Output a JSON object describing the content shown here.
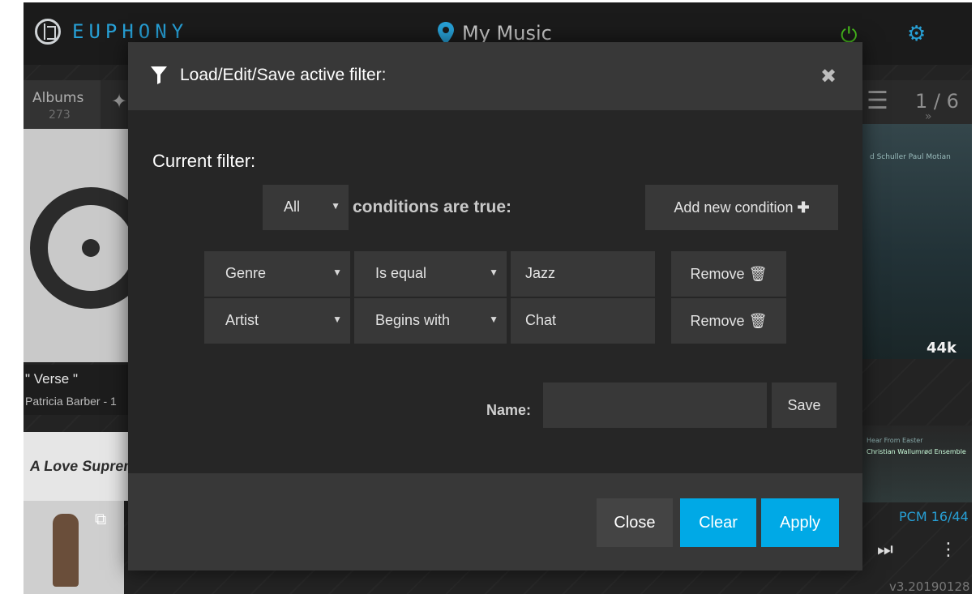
{
  "app": {
    "brand": "EUPHONY",
    "location": "My Music",
    "version": "v3.20190128"
  },
  "toolbar": {
    "albums_label": "Albums",
    "albums_count": "273",
    "pager": "1 / 6"
  },
  "background": {
    "album_title": "\" Verse \"",
    "album_artist": "Patricia Barber - 1",
    "album2": "A Love Supreme",
    "right_cover_text": "d Schuller  Paul Motian",
    "sample_rate": "44k",
    "right_album_line1": "Hear From Easter",
    "right_album_line2": "Christian Wallumrød Ensemble",
    "format": "PCM 16/44"
  },
  "modal": {
    "title": "Load/Edit/Save active filter:",
    "current_filter_label": "Current filter:",
    "match_mode": "All",
    "conditions_text": "conditions are true:",
    "add_condition_label": "Add new condition",
    "conditions": [
      {
        "field": "Genre",
        "operator": "Is equal",
        "value": "Jazz",
        "remove_label": "Remove"
      },
      {
        "field": "Artist",
        "operator": "Begins with",
        "value": "Chat",
        "remove_label": "Remove"
      }
    ],
    "name_label": "Name:",
    "name_value": "",
    "save_label": "Save",
    "close_label": "Close",
    "clear_label": "Clear",
    "apply_label": "Apply"
  },
  "colors": {
    "accent_blue": "#27a0d6",
    "power_green": "#49c21d",
    "primary_button": "#00a9e6",
    "modal_bg": "#262626",
    "control_bg": "#383838"
  },
  "icons": {
    "logo": "euphony-logo-icon",
    "location": "map-marker-icon",
    "power": "power-icon",
    "settings": "gear-icon",
    "wand": "magic-wand-icon",
    "list": "list-icon",
    "filter": "filter-icon",
    "close": "close-icon",
    "add": "plus-icon",
    "remove": "trash-icon",
    "next": "skip-next-icon",
    "more": "more-vertical-icon"
  }
}
